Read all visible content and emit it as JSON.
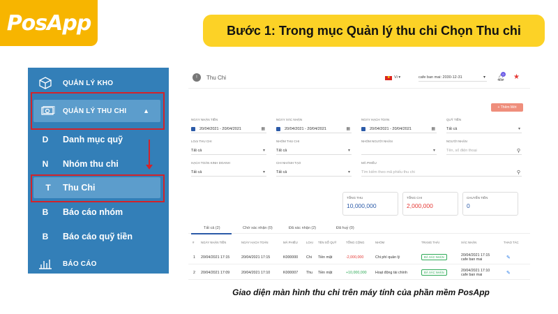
{
  "logo": {
    "text": "PosApp"
  },
  "banner": {
    "text": "Bước 1: Trong mục Quản lý thu chi Chọn Thu chi"
  },
  "sidebar": {
    "items": [
      {
        "icon": "box-icon",
        "label": "QUẢN LÝ KHO"
      },
      {
        "icon": "money-icon",
        "label": "QUẢN LÝ THU CHI"
      },
      {
        "letter": "D",
        "label": "Danh mục quỹ"
      },
      {
        "letter": "N",
        "label": "Nhóm thu chi"
      },
      {
        "letter": "T",
        "label": "Thu Chi"
      },
      {
        "letter": "B",
        "label": "Báo cáo nhóm"
      },
      {
        "letter": "B",
        "label": "Báo cáo quỹ tiền"
      },
      {
        "icon": "bar-chart-icon",
        "label": "BÁO CÁO"
      }
    ],
    "accent": "#d2232a"
  },
  "app": {
    "title": "Thu Chi",
    "home_letter": "!",
    "lang": "Vi",
    "shop": "cafe ban mai: 2030-12-31",
    "bell_count": "0",
    "add_button": "+ Thêm Mới",
    "filters": {
      "ngay_nhan_tien": {
        "label": "Ngày nhận tiền",
        "value": "20/04/2021 - 20/04/2021"
      },
      "ngay_xac_nhan": {
        "label": "Ngày xác nhận",
        "value": "20/04/2021 - 20/04/2021"
      },
      "ngay_hach_toan": {
        "label": "Ngày hạch toán",
        "value": "20/04/2021 - 20/04/2021"
      },
      "quy_tien": {
        "label": "Quỹ tiền",
        "value": "Tất cả"
      },
      "loai_thu_chi": {
        "label": "Loại thu chi",
        "value": "Tất cả"
      },
      "nhom_thu_chi": {
        "label": "Nhóm thu chi",
        "value": "Tất cả"
      },
      "nhom_nguoi_nhan": {
        "label": "Nhóm người nhận",
        "value": ""
      },
      "nguoi_nhan": {
        "label": "Người nhận",
        "placeholder": "Tên, số điện thoại"
      },
      "hach_toan_kinh_doanh": {
        "label": "Hạch toán kinh doanh",
        "value": "Tất cả"
      },
      "chi_nhanh_tao": {
        "label": "Chi nhánh tạo",
        "value": "Tất cả"
      },
      "ma_phieu": {
        "label": "Mã phiếu",
        "placeholder": "Tìm kiếm theo mã phiếu thu chi"
      }
    },
    "stats": [
      {
        "label": "Tổng thu",
        "value": "10,000,000",
        "color": "#2b5aa8"
      },
      {
        "label": "Tổng chi",
        "value": "2,000,000",
        "color": "#e53935"
      },
      {
        "label": "Chuyển tiền",
        "value": "0",
        "color": "#2b5aa8"
      }
    ],
    "tabs": [
      {
        "label": "Tất cả (2)"
      },
      {
        "label": "Chờ xác nhận (0)"
      },
      {
        "label": "Đã xác nhận (2)"
      },
      {
        "label": "Đã huỷ (0)"
      }
    ],
    "table": {
      "headers": [
        "#",
        "Ngày nhận tiền",
        "Ngày hạch toán",
        "Mã phiếu",
        "Loại",
        "Tên sổ quỹ",
        "Tổng cộng",
        "Nhóm",
        "Trạng thái",
        "Xác nhận",
        "Thao tác"
      ],
      "rows": [
        {
          "no": "1",
          "ngay_nhan": "20/04/2021 17:15",
          "ngay_hach_toan": "20/04/2021 17:15",
          "ma": "K000000",
          "loai": "Chi",
          "so_quy": "Tiền mặt",
          "tong": "-2,000,000",
          "nhom": "Chi phí quản lý",
          "trang_thai": "ĐÃ XÁC NHẬN",
          "xac_nhan_time": "20/04/2021 17:15",
          "xac_nhan_by": "cafe ban mai"
        },
        {
          "no": "2",
          "ngay_nhan": "20/04/2021 17:09",
          "ngay_hach_toan": "20/04/2021 17:10",
          "ma": "K000007",
          "loai": "Thu",
          "so_quy": "Tiền mặt",
          "tong": "+10,000,000",
          "nhom": "Hoạt động tài chính",
          "trang_thai": "ĐÃ XÁC NHẬN",
          "xac_nhan_time": "20/04/2021 17:10",
          "xac_nhan_by": "cafe ban mai"
        }
      ]
    }
  },
  "caption": "Giao diện màn hình thu chi trên máy tính của phần mềm PosApp"
}
